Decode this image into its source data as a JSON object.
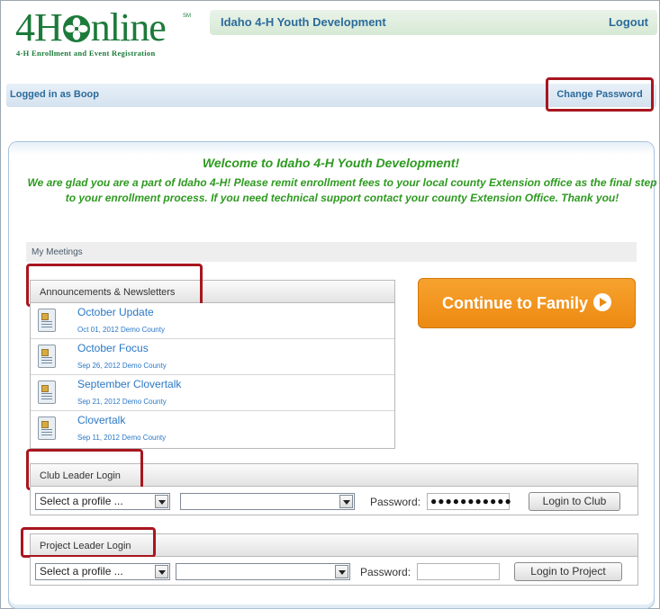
{
  "logo": {
    "word_prefix": "4H",
    "word_suffix": "nline",
    "mark": "SM",
    "tagline": "4-H Enrollment and Event Registration"
  },
  "header": {
    "org_title": "Idaho 4-H Youth Development",
    "logout": "Logout"
  },
  "userbar": {
    "logged_in": "Logged in as Boop",
    "change_password": "Change Password"
  },
  "welcome": {
    "title": "Welcome to Idaho 4-H Youth Development!",
    "message": "We are glad you are a part of Idaho 4-H!  Please remit enrollment fees to your local county Extension office as the final step to your enrollment process.  If you need technical support contact your county Extension Office.  Thank you!"
  },
  "meetings": {
    "label": "My Meetings"
  },
  "announcements": {
    "header": "Announcements & Newsletters",
    "items": [
      {
        "title": "October Update",
        "meta": "Oct 01, 2012 Demo County"
      },
      {
        "title": "October Focus",
        "meta": "Sep 26, 2012 Demo County"
      },
      {
        "title": "September Clovertalk",
        "meta": "Sep 21, 2012 Demo County"
      },
      {
        "title": "Clovertalk",
        "meta": "Sep 11, 2012 Demo County"
      }
    ]
  },
  "continue": {
    "label": "Continue to Family"
  },
  "club_login": {
    "header": "Club Leader Login",
    "profile_select": "Select a profile ...",
    "club_select": "",
    "password_label": "Password:",
    "password_value": "●●●●●●●●●●●",
    "button": "Login to Club"
  },
  "project_login": {
    "header": "Project Leader Login",
    "profile_select": "Select a profile ...",
    "project_select": "",
    "password_label": "Password:",
    "password_value": "",
    "button": "Login to Project"
  },
  "colors": {
    "brand_green": "#1c7a3a",
    "welcome_green": "#2e9a20",
    "link_blue": "#2b78c5",
    "highlight_red": "#a8161f",
    "cta_orange": "#ec8a12"
  }
}
